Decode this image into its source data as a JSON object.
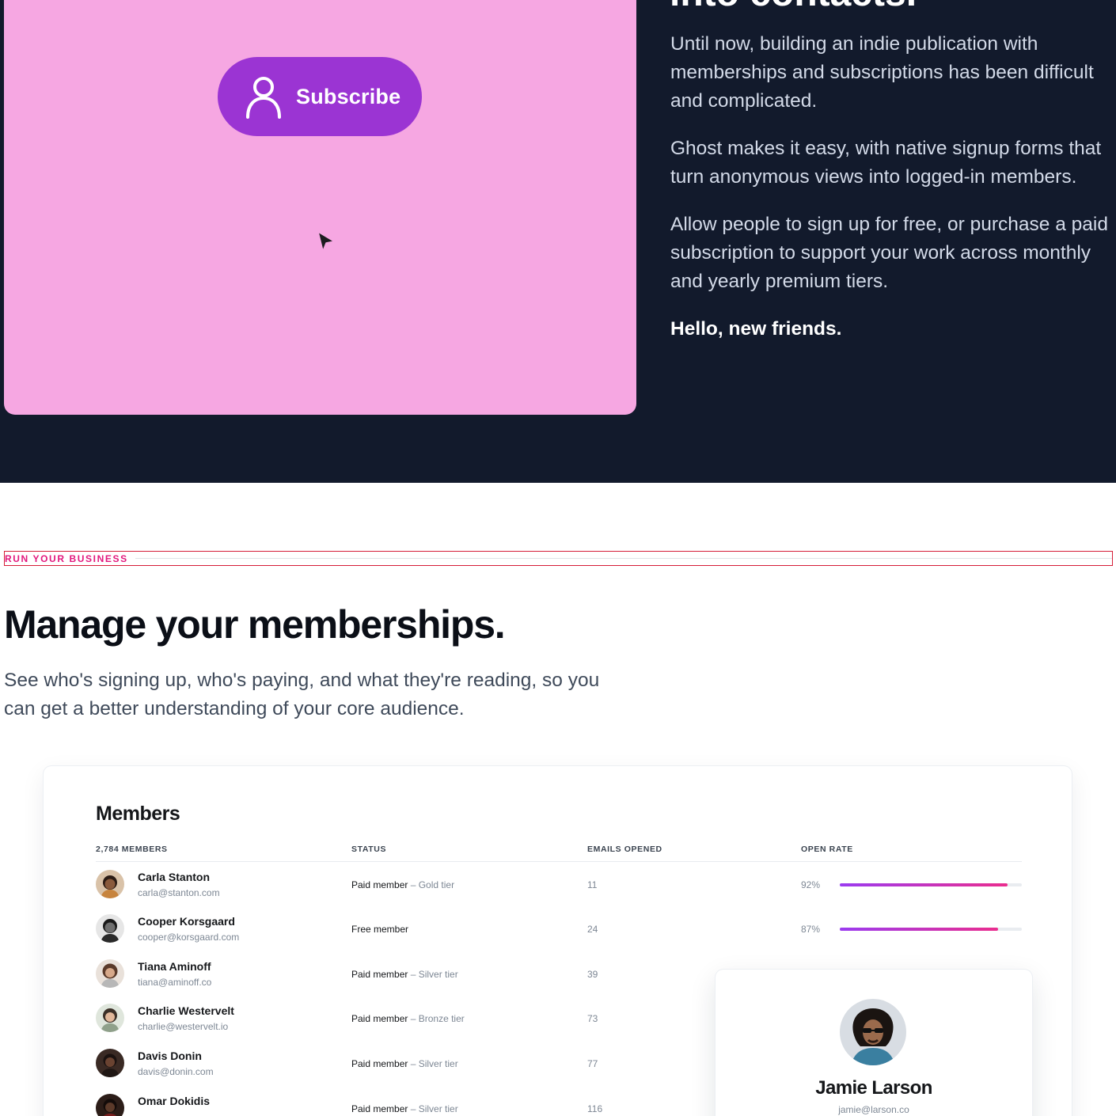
{
  "hero": {
    "heading_partial": "into contacts.",
    "paragraphs": [
      "Until now, building an indie publication with memberships and subscriptions has been difficult and complicated.",
      "Ghost makes it easy, with native signup forms that turn anonymous views into logged-in members.",
      "Allow people to sign up for free, or purchase a paid subscription to support your work across monthly and yearly premium tiers."
    ],
    "closing": "Hello, new friends.",
    "subscribe_label": "Subscribe",
    "subscribe_icon": "user-icon",
    "cursor_icon": "cursor-arrow-icon"
  },
  "section": {
    "eyebrow": "RUN YOUR BUSINESS",
    "title": "Manage your memberships.",
    "lead": "See who's signing up, who's paying, and what they're reading, so you can get a better understanding of your core audience."
  },
  "members": {
    "title": "Members",
    "columns": {
      "count": "2,784 MEMBERS",
      "status": "STATUS",
      "emails_opened": "EMAILS OPENED",
      "open_rate": "OPEN RATE"
    },
    "rows": [
      {
        "name": "Carla Stanton",
        "email": "carla@stanton.com",
        "status": "Paid member",
        "tier": " – Gold tier",
        "opened": "11",
        "rate": "92%",
        "rate_value": 0.92
      },
      {
        "name": "Cooper Korsgaard",
        "email": "cooper@korsgaard.com",
        "status": "Free member",
        "tier": "",
        "opened": "24",
        "rate": "87%",
        "rate_value": 0.87
      },
      {
        "name": "Tiana Aminoff",
        "email": "tiana@aminoff.co",
        "status": "Paid member",
        "tier": " – Silver tier",
        "opened": "39",
        "rate": "",
        "rate_value": null
      },
      {
        "name": "Charlie Westervelt",
        "email": "charlie@westervelt.io",
        "status": "Paid member",
        "tier": " – Bronze tier",
        "opened": "73",
        "rate": "",
        "rate_value": null
      },
      {
        "name": "Davis Donin",
        "email": "davis@donin.com",
        "status": "Paid member",
        "tier": " – Silver tier",
        "opened": "77",
        "rate": "",
        "rate_value": null
      },
      {
        "name": "Omar Dokidis",
        "email": "",
        "status": "Paid member",
        "tier": " – Silver tier",
        "opened": "116",
        "rate": "",
        "rate_value": null
      }
    ]
  },
  "profile": {
    "name": "Jamie Larson",
    "email": "jamie@larson.co"
  },
  "colors": {
    "dark_bg": "#121a2c",
    "pink_card": "#f6a7e2",
    "subscribe_button": "#9b34d3",
    "eyebrow_accent": "#e2187d",
    "bar_gradient_start": "#9b3bf0",
    "bar_gradient_end": "#ea2d8e"
  }
}
